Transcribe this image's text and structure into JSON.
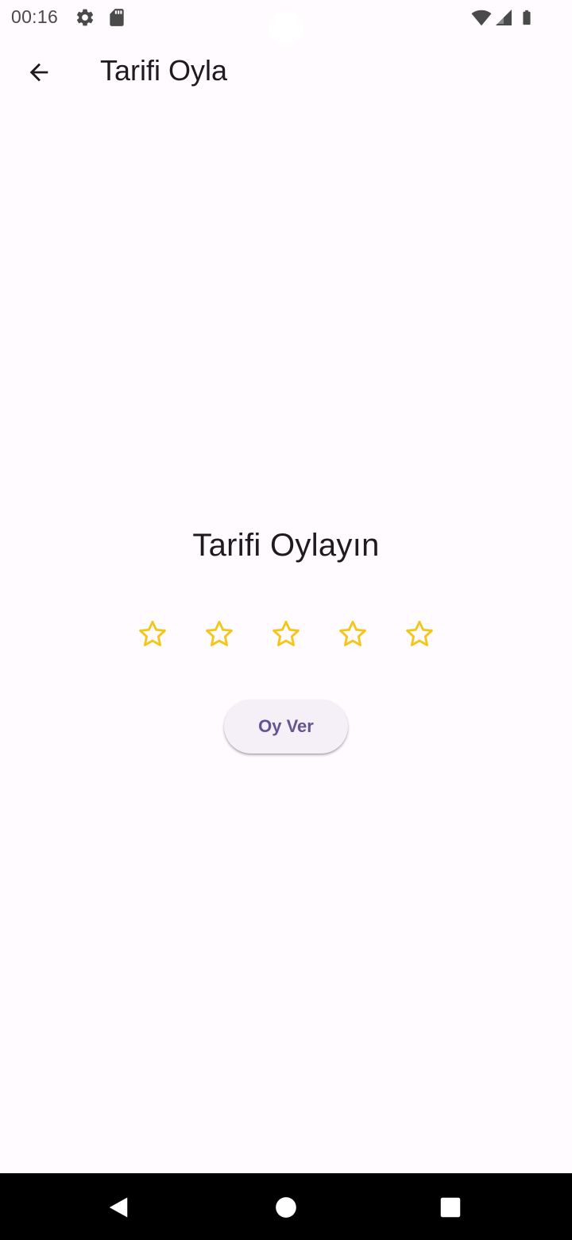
{
  "status_bar": {
    "time": "00:16",
    "icons": [
      "settings-icon",
      "sd-card-icon",
      "wifi-icon",
      "signal-icon",
      "battery-icon"
    ]
  },
  "app_bar": {
    "back_icon": "arrow-back-icon",
    "title": "Tarifi Oyla"
  },
  "main": {
    "heading": "Tarifi Oylayın",
    "rating": {
      "max": 5,
      "value": 0,
      "star_icon": "star-outline-icon",
      "star_color": "#f5c518"
    },
    "vote_button_label": "Oy Ver"
  },
  "nav_bar": {
    "items": [
      "back-nav-icon",
      "home-nav-icon",
      "recents-nav-icon"
    ]
  },
  "colors": {
    "background": "#fffbfe",
    "accent": "#65558f",
    "button_bg": "#f5eff8",
    "text": "#1d1b20"
  }
}
